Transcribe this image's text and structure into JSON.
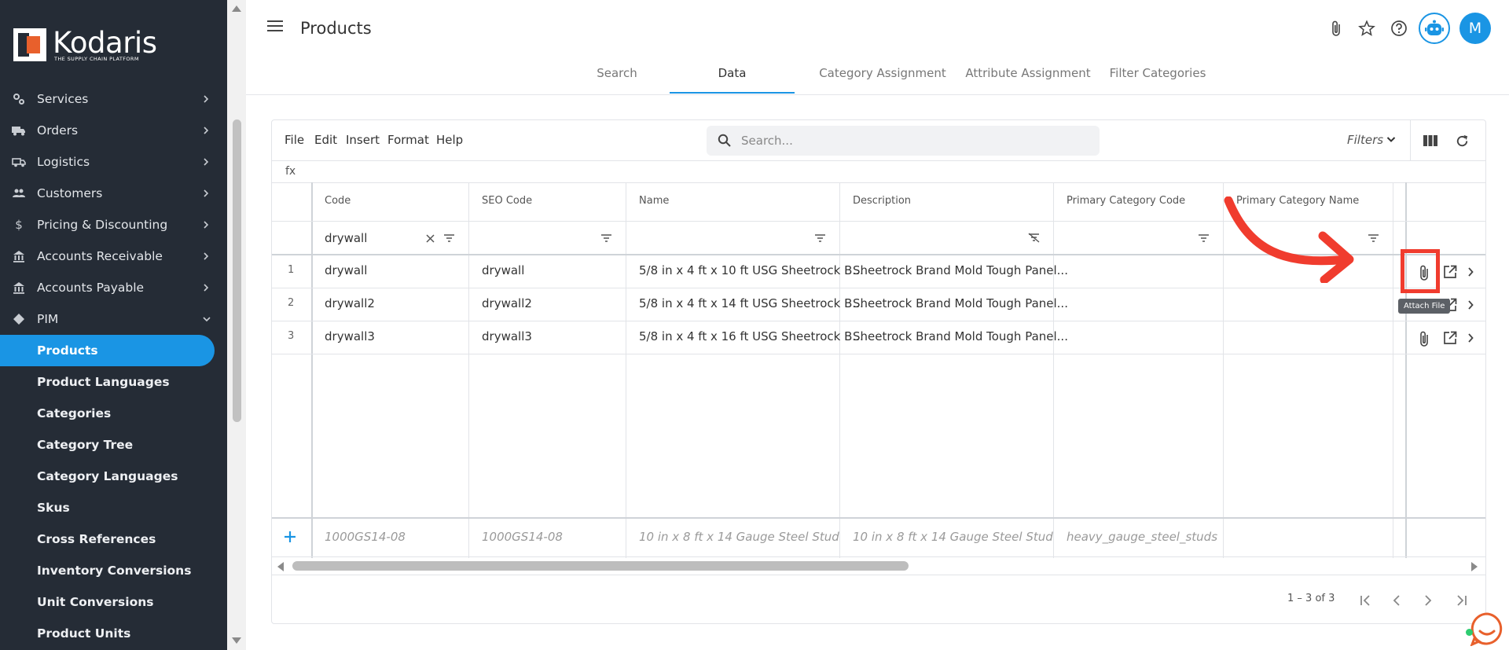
{
  "brand": {
    "name": "Kodaris",
    "tagline": "THE SUPPLY CHAIN PLATFORM",
    "accent": "#1a95e4",
    "sidebar_bg": "#252c36",
    "logo_color": "#e8602c",
    "highlight": "#f03c2e"
  },
  "sidebar": {
    "items": [
      {
        "label": "Services",
        "icon": "services-icon"
      },
      {
        "label": "Orders",
        "icon": "truck-icon"
      },
      {
        "label": "Logistics",
        "icon": "shipping-icon"
      },
      {
        "label": "Customers",
        "icon": "people-icon"
      },
      {
        "label": "Pricing & Discounting",
        "icon": "dollar-icon"
      },
      {
        "label": "Accounts Receivable",
        "icon": "bank-icon"
      },
      {
        "label": "Accounts Payable",
        "icon": "bank-icon"
      },
      {
        "label": "PIM",
        "icon": "tag-icon"
      }
    ],
    "sub_items": [
      "Products",
      "Product Languages",
      "Categories",
      "Category Tree",
      "Category Languages",
      "Skus",
      "Cross References",
      "Inventory Conversions",
      "Unit Conversions",
      "Product Units"
    ],
    "active": "Products"
  },
  "header": {
    "title": "Products",
    "avatar_initial": "M"
  },
  "tabs": [
    "Search",
    "Data",
    "Category Assignment",
    "Attribute Assignment",
    "Filter Categories"
  ],
  "active_tab": "Data",
  "menu": [
    "File",
    "Edit",
    "Insert",
    "Format",
    "Help"
  ],
  "search": {
    "placeholder": "Search..."
  },
  "filters_label": "Filters",
  "formula_label": "fx",
  "columns": [
    "Code",
    "SEO Code",
    "Name",
    "Description",
    "Primary Category Code",
    "Primary Category Name"
  ],
  "filter_value": "drywall",
  "rows": [
    {
      "num": "1",
      "code": "drywall",
      "seo": "drywall",
      "name": "5/8 in x 4 ft x 10 ft USG Sheetrock B...",
      "desc": "Sheetrock Brand Mold Tough Panel..."
    },
    {
      "num": "2",
      "code": "drywall2",
      "seo": "drywall2",
      "name": "5/8 in x 4 ft x 14 ft USG Sheetrock B...",
      "desc": "Sheetrock Brand Mold Tough Panel..."
    },
    {
      "num": "3",
      "code": "drywall3",
      "seo": "drywall3",
      "name": "5/8 in x 4 ft x 16 ft USG Sheetrock B...",
      "desc": "Sheetrock Brand Mold Tough Panel..."
    }
  ],
  "new_row": {
    "code": "1000GS14-08",
    "seo": "1000GS14-08",
    "name": "10 in x 8 ft x 14 Gauge Steel Stud",
    "desc": "10 in x 8 ft x 14 Gauge Steel Stud",
    "cat": "heavy_gauge_steel_studs"
  },
  "tooltip": "Attach File",
  "pager": {
    "range": "1 – 3 of 3"
  }
}
